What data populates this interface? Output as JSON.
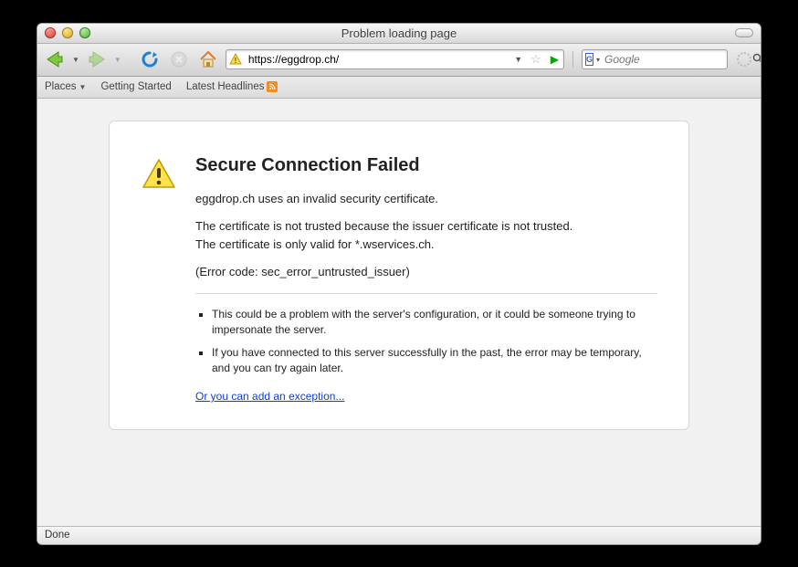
{
  "window": {
    "title": "Problem loading page"
  },
  "toolbar": {
    "url": "https://eggdrop.ch/",
    "search_placeholder": "Google",
    "engine_badge": "G"
  },
  "bookmarks": {
    "places": "Places",
    "getting_started": "Getting Started",
    "latest_headlines": "Latest Headlines"
  },
  "error": {
    "heading": "Secure Connection Failed",
    "intro": "eggdrop.ch uses an invalid security certificate.",
    "reason1": "The certificate is not trusted because the issuer certificate is not trusted.",
    "reason2": "The certificate is only valid for *.wservices.ch.",
    "code": "(Error code: sec_error_untrusted_issuer)",
    "bullet1": "This could be a problem with the server's configuration, or it could be someone trying to impersonate the server.",
    "bullet2": "If you have connected to this server successfully in the past, the error may be temporary, and you can try again later.",
    "exception_link": "Or you can add an exception..."
  },
  "status": {
    "text": "Done"
  }
}
